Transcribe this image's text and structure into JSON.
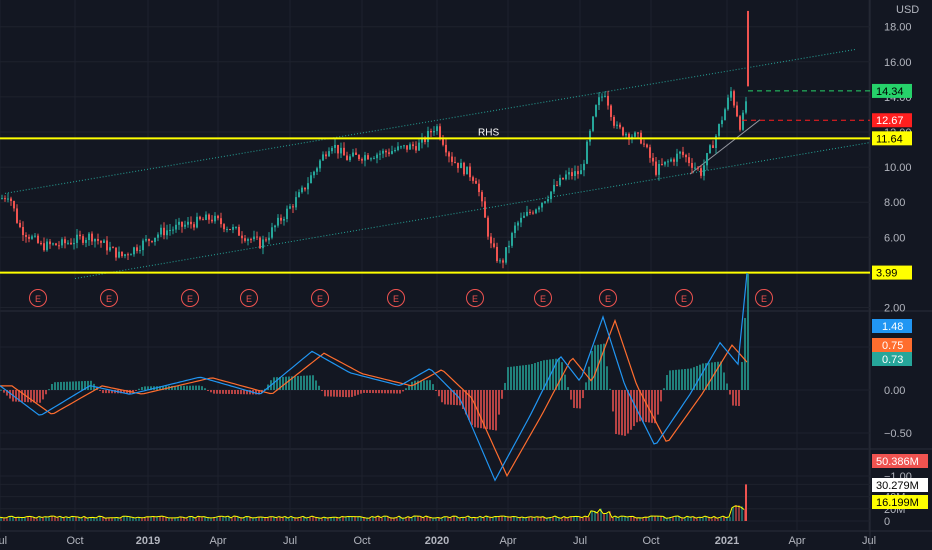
{
  "currency": "USD",
  "price_axis": {
    "ticks": [
      {
        "value": 2,
        "label": "2.00"
      },
      {
        "value": 4,
        "label": "4.00"
      },
      {
        "value": 6,
        "label": "6.00"
      },
      {
        "value": 8,
        "label": "8.00"
      },
      {
        "value": 10,
        "label": "10.00"
      },
      {
        "value": 12,
        "label": "12.00"
      },
      {
        "value": 14,
        "label": "14.00"
      },
      {
        "value": 16,
        "label": "16.00"
      },
      {
        "value": 18,
        "label": "18.00"
      }
    ],
    "range": [
      2,
      19
    ]
  },
  "price_tags": [
    {
      "value": 14.34,
      "label": "14.34",
      "bg": "#26d26a",
      "fg": "#000000"
    },
    {
      "value": 12.67,
      "label": "12.67",
      "bg": "#ff1f1f",
      "fg": "#ffffff"
    },
    {
      "value": 11.64,
      "label": "11.64",
      "bg": "#ffff00",
      "fg": "#000000"
    },
    {
      "value": 3.99,
      "label": "3.99",
      "bg": "#ffff00",
      "fg": "#000000"
    }
  ],
  "horizontal_levels": [
    {
      "value": 11.64,
      "color": "#ffff00",
      "label": "RHS"
    },
    {
      "value": 3.99,
      "color": "#ffff00",
      "label": ""
    }
  ],
  "earnings_marker": "E",
  "earnings_count": 11,
  "macd": {
    "ticks": [
      {
        "value": 0.5,
        "label": "0.50"
      },
      {
        "value": 0,
        "label": "0.00"
      },
      {
        "value": -0.5,
        "label": "−0.50"
      },
      {
        "value": -1,
        "label": "−1.00"
      }
    ],
    "tags": [
      {
        "value": 1.48,
        "label": "1.48",
        "bg": "#2196f3",
        "fg": "#ffffff"
      },
      {
        "value": 0.75,
        "label": "0.75",
        "bg": "#ff6d2e",
        "fg": "#ffffff"
      },
      {
        "value": 0.73,
        "label": "0.73",
        "bg": "#26a69a",
        "fg": "#ffffff"
      }
    ]
  },
  "volume": {
    "ticks": [
      {
        "value": 60,
        "label": "60M"
      },
      {
        "value": 40,
        "label": "40M"
      },
      {
        "value": 20,
        "label": "20M"
      },
      {
        "value": 0,
        "label": "0"
      }
    ],
    "tags": [
      {
        "value": 50.386,
        "label": "50.386M",
        "bg": "#ef5350",
        "fg": "#ffffff"
      },
      {
        "value": 30.279,
        "label": "30.279M",
        "bg": "#ffffff",
        "fg": "#000000"
      },
      {
        "value": 16.199,
        "label": "16.199M",
        "bg": "#ffff00",
        "fg": "#000000"
      }
    ]
  },
  "time_axis": {
    "labels": [
      {
        "label": "Jul",
        "bold": false
      },
      {
        "label": "Oct",
        "bold": false
      },
      {
        "label": "2019",
        "bold": true
      },
      {
        "label": "Apr",
        "bold": false
      },
      {
        "label": "Jul",
        "bold": false
      },
      {
        "label": "Oct",
        "bold": false
      },
      {
        "label": "2020",
        "bold": true
      },
      {
        "label": "Apr",
        "bold": false
      },
      {
        "label": "Jul",
        "bold": false
      },
      {
        "label": "Oct",
        "bold": false
      },
      {
        "label": "2021",
        "bold": true
      },
      {
        "label": "Apr",
        "bold": false
      },
      {
        "label": "Jul",
        "bold": false
      }
    ]
  },
  "colors": {
    "background": "#131722",
    "up": "#26a69a",
    "down": "#ef5350",
    "channel": "#26a69a",
    "macd_line": "#2196f3",
    "signal_line": "#ff6d2e",
    "earnings": "#ef5350",
    "level": "#ffff00"
  }
}
